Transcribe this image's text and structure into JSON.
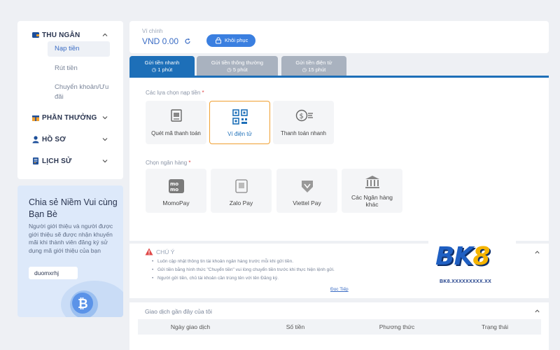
{
  "sidebar": {
    "sections": [
      {
        "label": "THU NGÂN",
        "icon": "wallet-icon"
      },
      {
        "label": "PHẦN THƯỞNG",
        "icon": "gift-icon"
      },
      {
        "label": "HỒ SƠ",
        "icon": "user-icon"
      },
      {
        "label": "LỊCH SỬ",
        "icon": "document-icon"
      }
    ],
    "sub_items": [
      "Nạp tiền",
      "Rút tiền",
      "Chuyển khoản/Ưu đãi"
    ]
  },
  "promo": {
    "title": "Chia sẻ Niềm Vui cùng Bạn Bè",
    "description": "Người giới thiệu và người được giới thiệu sẽ được nhận khuyến mãi khi thành viên đăng ký sử dụng mã giới thiệu của bạn",
    "referral_code": "duomxrhj"
  },
  "wallet": {
    "label": "Ví chính",
    "value": "VND 0.00",
    "restore_label": "Khôi phục"
  },
  "tabs": [
    {
      "title": "Gửi tiền nhanh",
      "time": "1 phút"
    },
    {
      "title": "Gửi tiền thông thường",
      "time": "5 phút"
    },
    {
      "title": "Gửi tiền điện tử",
      "time": "15 phút"
    }
  ],
  "deposit": {
    "options_label": "Các lựa chọn nạp tiền",
    "options": [
      "Quét mã thanh toán",
      "Ví điện tử",
      "Thanh toán nhanh"
    ],
    "bank_label": "Chọn ngân hàng",
    "banks": [
      "MomoPay",
      "Zalo Pay",
      "Viettel Pay",
      "Các Ngân hàng khác"
    ],
    "required_mark": "*"
  },
  "notice": {
    "title": "CHÚ Ý",
    "lines": [
      "Luôn cập nhật thông tin tài khoản ngân hàng trước mỗi khi gửi tiền.",
      "Gửi tiền bằng hình thức \"Chuyển tiền\" vui lòng chuyển tiền trước khi thực hiện lệnh gửi.",
      "Người gửi tiền, chủ tài khoản cần trùng tên với tên Đăng ký."
    ],
    "read_more": "Đọc Tiếp"
  },
  "logo": {
    "brand": "BK",
    "brand_num": "8",
    "sub": "BK8.XXXXXXXXX.XX"
  },
  "history": {
    "title": "Giao dịch gần đây của tôi",
    "columns": [
      "Ngày giao dịch",
      "Số tiền",
      "Phương thức",
      "Trạng thái"
    ]
  },
  "colors": {
    "primary": "#1d6fb8",
    "accent": "#f0a030",
    "button": "#3a7fe0"
  }
}
